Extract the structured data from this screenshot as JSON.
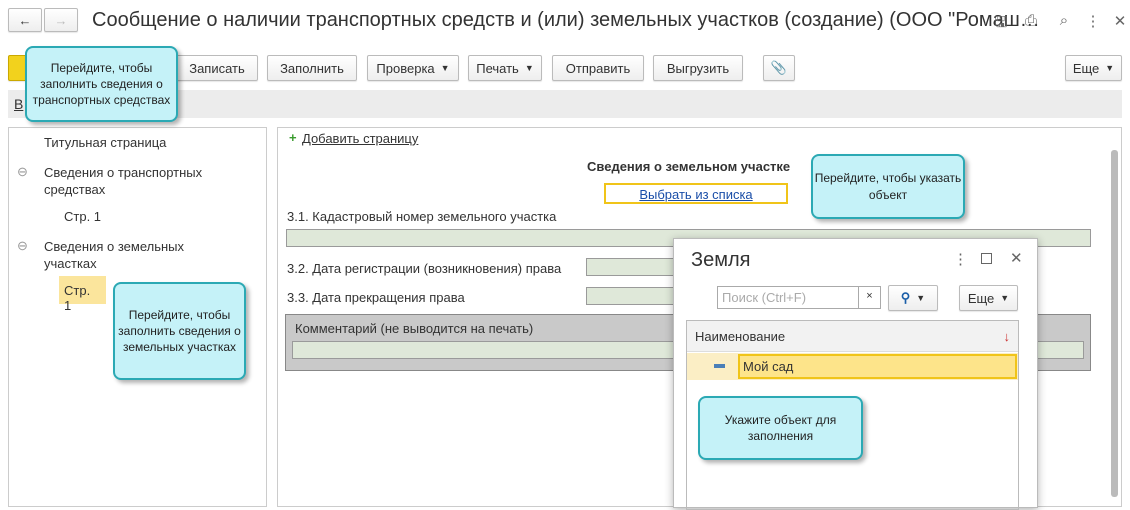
{
  "header": {
    "title": "Сообщение о наличии транспортных средств и (или) земельных участков (создание) (ООО \"Ромаш…",
    "back": "←",
    "forward": "→"
  },
  "toolbar": {
    "save": "Записать",
    "fill": "Заполнить",
    "check": "Проверка",
    "print": "Печать",
    "send": "Отправить",
    "export": "Выгрузить",
    "more": "Еще"
  },
  "subbar": {
    "link": "В"
  },
  "tree": {
    "title_page": "Титульная страница",
    "vehicles": "Сведения о транспортных средствах",
    "vehicles_page": "Стр. 1",
    "land": "Сведения о земельных участках",
    "land_page": "Стр. 1",
    "collapse": "⊖"
  },
  "form": {
    "add_page": "Добавить страницу",
    "section_title": "Сведения о земельном участке",
    "choose": "Выбрать из списка",
    "cadastral": "3.1. Кадастровый номер земельного участка",
    "reg_date": "3.2. Дата регистрации (возникновения) права",
    "end_date": "3.3. Дата прекращения права",
    "comment": "Комментарий (не выводится на печать)"
  },
  "dialog": {
    "title": "Земля",
    "search_placeholder": "Поиск (Ctrl+F)",
    "clear": "×",
    "more": "Еще",
    "column": "Наименование",
    "sort": "↓",
    "row": "Мой сад"
  },
  "tips": {
    "t1": "Перейдите, чтобы заполнить сведения о транспортных средствах",
    "t2": "Перейдите, чтобы указать объект",
    "t3": "Перейдите, чтобы заполнить сведения о земельных участках",
    "t4": "Укажите объект для заполнения"
  }
}
